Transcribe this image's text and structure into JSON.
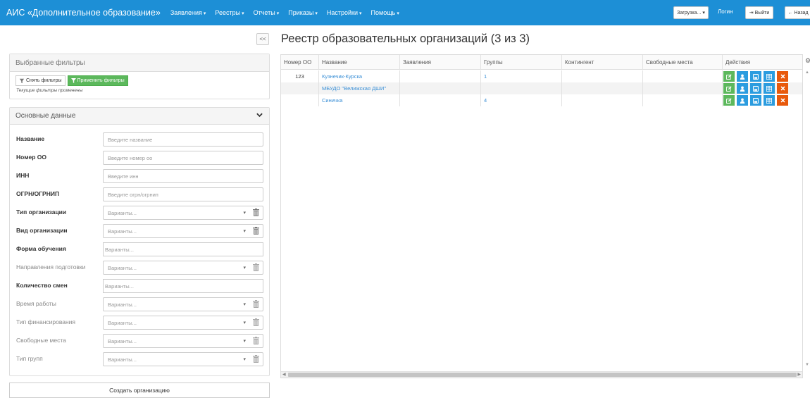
{
  "app": {
    "title": "АИС «Дополнительное образование»",
    "menu": [
      {
        "label": "Заявления"
      },
      {
        "label": "Реестры"
      },
      {
        "label": "Отчеты"
      },
      {
        "label": "Приказы"
      },
      {
        "label": "Настройки"
      },
      {
        "label": "Помощь"
      }
    ],
    "load_label": "Загрузка...",
    "login_label": "Логин",
    "logout_label": "Выйти",
    "back_label": "Назад"
  },
  "sidebar": {
    "collapse_label": "<<",
    "selected_filters": {
      "title": "Выбранные фильтры",
      "clear_label": "Снять фильтры",
      "apply_label": "Применить фильтры",
      "note": "Текущие фильтры применены"
    },
    "main_data": {
      "title": "Основные данные",
      "fields": [
        {
          "label": "Название",
          "placeholder": "Введите название"
        },
        {
          "label": "Номер ОО",
          "placeholder": "Введите номер оо"
        },
        {
          "label": "ИНН",
          "placeholder": "Введите инн"
        },
        {
          "label": "ОГРН/ОГРНИП",
          "placeholder": "Введите огрн/огрнип"
        },
        {
          "label": "Тип организации",
          "placeholder": "Варианты..."
        },
        {
          "label": "Вид организации",
          "placeholder": "Варианты..."
        },
        {
          "label": "Форма обучения",
          "placeholder": "Варианты..."
        },
        {
          "label": "Направления подготовки",
          "placeholder": "Варианты..."
        },
        {
          "label": "Количество смен",
          "placeholder": "Варианты..."
        },
        {
          "label": "Время работы",
          "placeholder": "Варианты..."
        },
        {
          "label": "Тип финансирования",
          "placeholder": "Варианты..."
        },
        {
          "label": "Свободные места",
          "placeholder": "Варианты..."
        },
        {
          "label": "Тип групп",
          "placeholder": "Варианты..."
        }
      ]
    },
    "create_label": "Создать организацию"
  },
  "main": {
    "title": "Реестр образовательных организаций (3 из 3)",
    "columns": [
      "Номер ОО",
      "Название",
      "Заявления",
      "Группы",
      "Контингент",
      "Свободные места",
      "Действия"
    ],
    "rows": [
      {
        "number": "123",
        "name": "Кузнечик-Курска",
        "applications": "",
        "groups": "1",
        "contingent": "",
        "free": ""
      },
      {
        "number": "",
        "name": "МБУДО \"Велижская ДШИ\"",
        "applications": "",
        "groups": "",
        "contingent": "",
        "free": ""
      },
      {
        "number": "",
        "name": "Синичка",
        "applications": "",
        "groups": "4",
        "contingent": "",
        "free": ""
      }
    ]
  },
  "colors": {
    "topbar": "#1d8fd6",
    "green": "#5cb85c",
    "blue": "#2b9cdf",
    "orange": "#e8590c",
    "link": "#3a8fd6"
  }
}
